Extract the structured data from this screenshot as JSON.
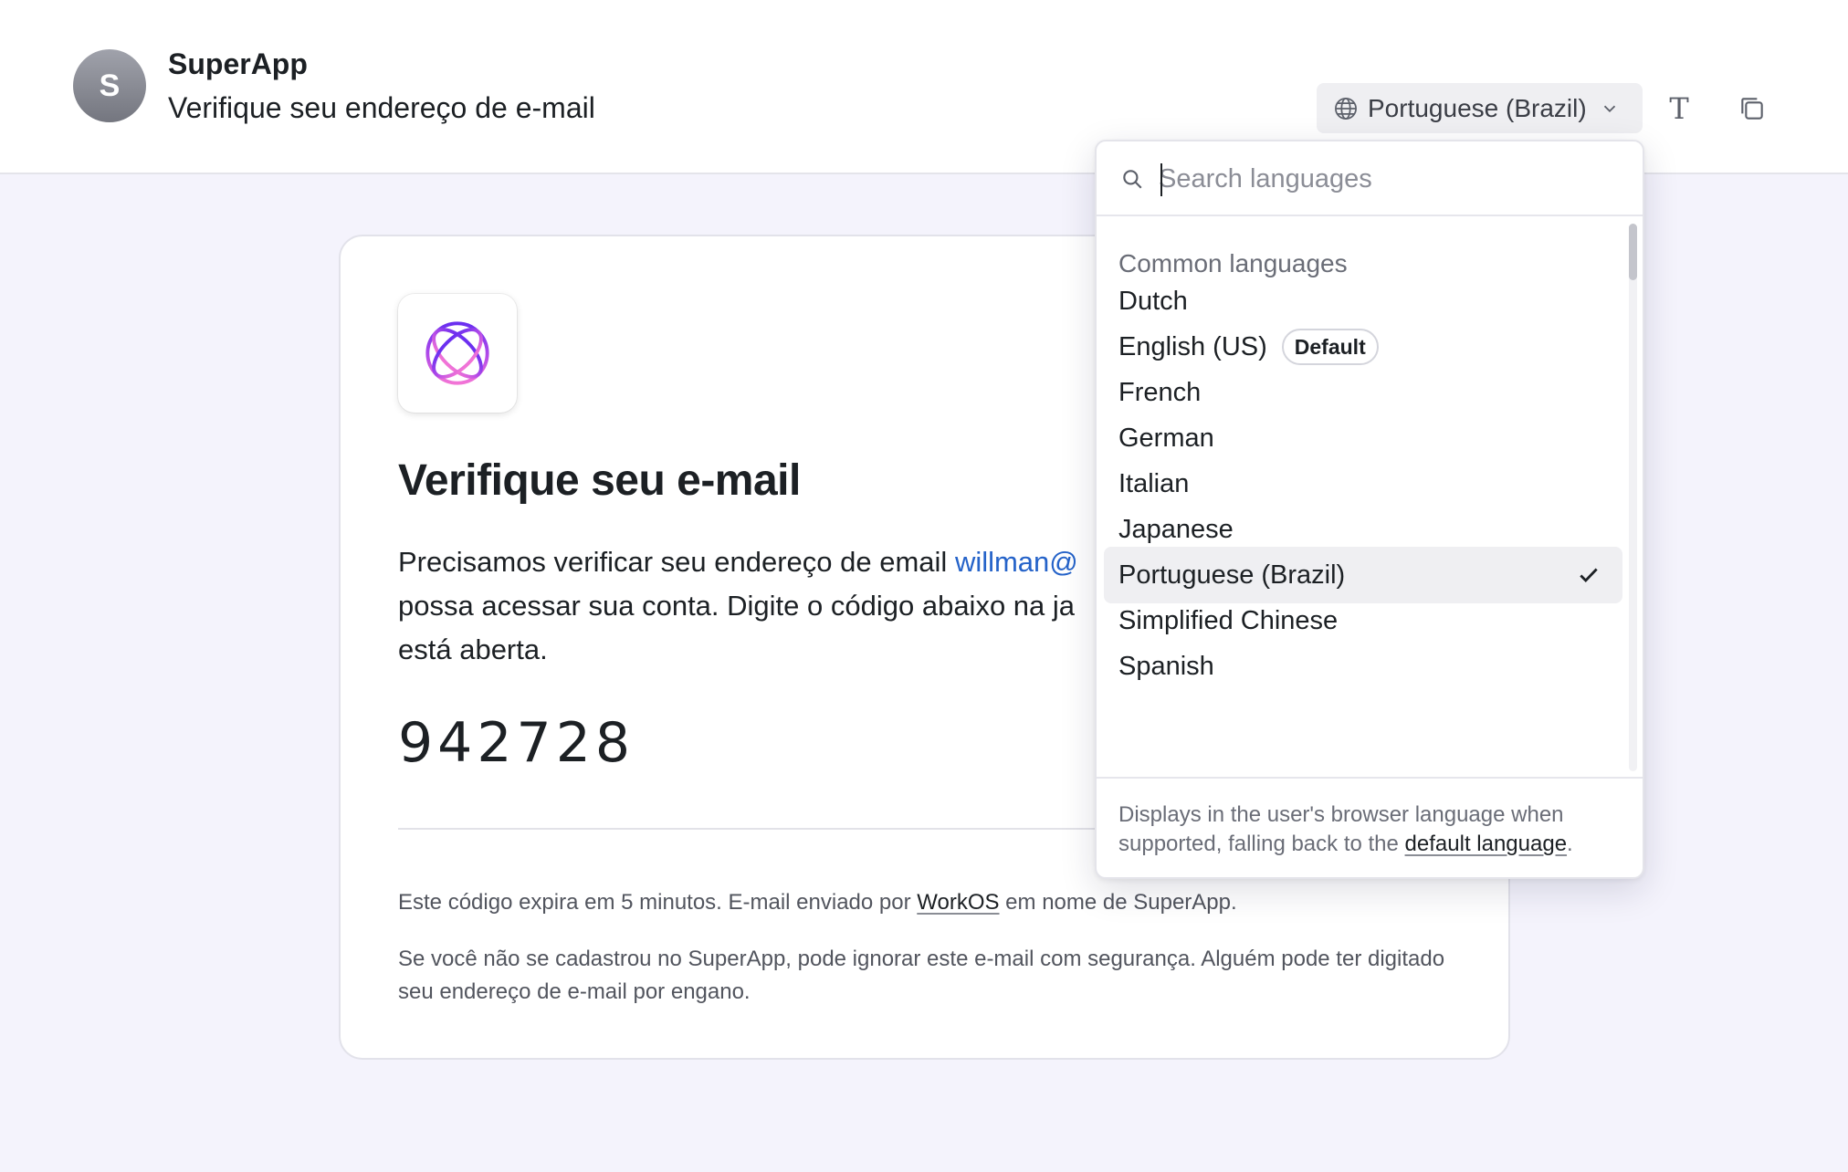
{
  "header": {
    "avatar_initial": "S",
    "app_name": "SuperApp",
    "subject": "Verifique seu endereço de e-mail",
    "language_button": "Portuguese (Brazil)"
  },
  "email": {
    "title": "Verifique seu e-mail",
    "body_line1_prefix": "Precisamos verificar seu endereço de email ",
    "body_email": "willman@",
    "body_line2": "possa acessar sua conta. Digite o código abaixo na ja",
    "body_line3": "está aberta.",
    "code": "942728",
    "footer_prefix": "Este código expira em 5 minutos. E-mail enviado por ",
    "footer_link": "WorkOS",
    "footer_suffix": " em nome de SuperApp.",
    "footer_note": "Se você não se cadastrou no SuperApp, pode ignorar este e-mail com segurança. Alguém pode ter digitado seu endereço de e-mail por engano."
  },
  "dropdown": {
    "search_placeholder": "Search languages",
    "group_label": "Common languages",
    "options": [
      {
        "label": "Dutch"
      },
      {
        "label": "English (US)",
        "badge": "Default"
      },
      {
        "label": "French"
      },
      {
        "label": "German"
      },
      {
        "label": "Italian"
      },
      {
        "label": "Japanese"
      },
      {
        "label": "Portuguese (Brazil)",
        "selected": true
      },
      {
        "label": "Simplified Chinese"
      },
      {
        "label": "Spanish"
      }
    ],
    "footer_prefix": "Displays in the user's browser language when supported, falling back to the ",
    "footer_link": "default language",
    "footer_suffix": "."
  },
  "colors": {
    "accent_link": "#2563c9",
    "page_bg": "#f4f3fc",
    "logo_gradient_top": "#7a2ff0",
    "logo_gradient_bottom": "#f06fd8"
  },
  "icons": {
    "language_button": "globe-icon",
    "language_chevron": "chevron-down-icon",
    "text_tool": "text-icon",
    "copy_tool": "copy-icon",
    "search": "search-icon",
    "selected": "checkmark-icon",
    "logo": "orbit-logo"
  }
}
